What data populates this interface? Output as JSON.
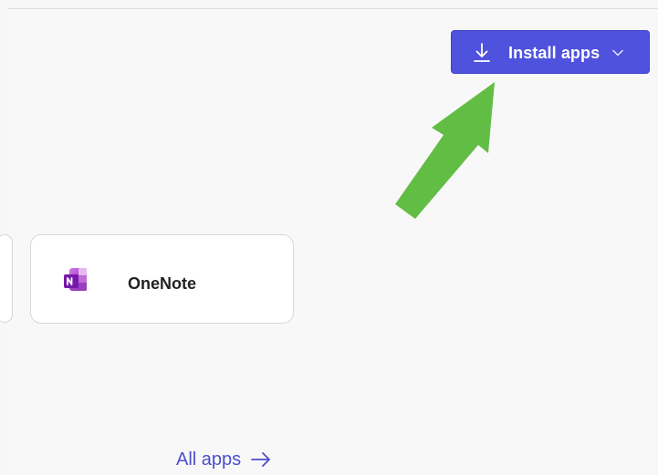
{
  "header": {
    "install_button": {
      "label": "Install apps",
      "icon": "download-icon",
      "dropdown_icon": "chevron-down-icon",
      "background": "#4f52dc",
      "text_color": "#ffffff"
    }
  },
  "annotation": {
    "arrow_color": "#62bd45",
    "points_to": "install-apps-button"
  },
  "apps": [
    {
      "name": "OneNote",
      "icon": "onenote-icon",
      "brand_color": "#8b2fb3"
    }
  ],
  "footer": {
    "all_apps_label": "All apps",
    "arrow_icon": "arrow-right-icon",
    "link_color": "#4b4fcc"
  }
}
